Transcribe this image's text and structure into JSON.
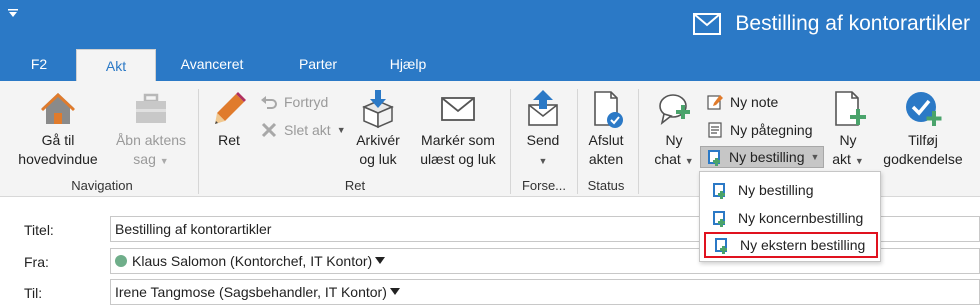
{
  "window": {
    "title": "Bestilling af kontorartikler"
  },
  "tabs": [
    {
      "label": "F2"
    },
    {
      "label": "Akt"
    },
    {
      "label": "Avanceret"
    },
    {
      "label": "Parter"
    },
    {
      "label": "Hjælp"
    }
  ],
  "ribbon": {
    "navigation": {
      "goto_line1": "Gå til",
      "goto_line2": "hovedvindue",
      "open_line1": "Åbn aktens",
      "open_line2": "sag",
      "group_label": "Navigation"
    },
    "ret": {
      "edit_label": "Ret",
      "undo_label": "Fortryd",
      "delete_label": "Slet akt",
      "archive_line1": "Arkivér",
      "archive_line2": "og luk",
      "mark_line1": "Markér som",
      "mark_line2": "ulæst og luk",
      "group_label": "Ret"
    },
    "forward": {
      "send_label": "Send",
      "group_label": "Forse..."
    },
    "status": {
      "close_line1": "Afslut",
      "close_line2": "akten",
      "group_label": "Status"
    },
    "new": {
      "chat_line1": "Ny",
      "chat_line2": "chat",
      "note_label": "Ny note",
      "endorsement_label": "Ny påtegning",
      "order_label": "Ny bestilling",
      "act_line1": "Ny",
      "act_line2": "akt",
      "approval_line1": "Tilføj",
      "approval_line2": "godkendelse"
    }
  },
  "dropdown": {
    "items": [
      {
        "label": "Ny bestilling"
      },
      {
        "label": "Ny koncernbestilling"
      },
      {
        "label": "Ny ekstern bestilling"
      }
    ]
  },
  "form": {
    "title_label": "Titel:",
    "title_value": "Bestilling af kontorartikler",
    "from_label": "Fra:",
    "from_value": "Klaus Salomon (Kontorchef, IT Kontor)",
    "to_label": "Til:",
    "to_value": "Irene Tangmose (Sagsbehandler, IT Kontor)"
  },
  "colors": {
    "accent": "#2b79c6",
    "ribbon_bg": "#f4f4f4",
    "highlight": "#e0121f",
    "icon_green": "#4aa36b"
  },
  "icons": [
    "mail-icon",
    "house-icon",
    "briefcase-icon",
    "pencil-icon",
    "undo-icon",
    "delete-icon",
    "archive-box-icon",
    "envelope-icon",
    "send-icon",
    "finish-document-icon",
    "chat-icon",
    "note-icon",
    "endorsement-icon",
    "order-icon",
    "new-act-icon",
    "approval-icon"
  ]
}
